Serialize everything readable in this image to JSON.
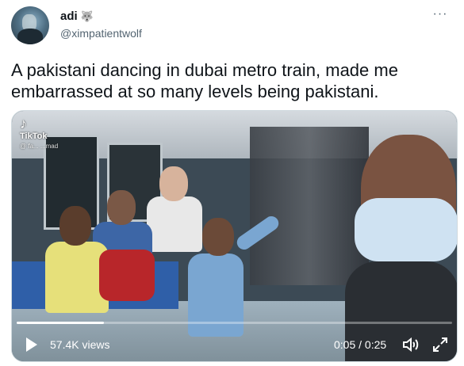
{
  "tweet": {
    "author": {
      "display_name": "adi",
      "name_emoji": "🐺",
      "handle": "@ximpatientwolf"
    },
    "more_label": "···",
    "text": "A pakistani dancing in dubai metro train, made me embarrassed at so many levels being pakistani.",
    "video": {
      "watermark": "TikTok",
      "watermark_user": "@ fa... ...mad",
      "views": "57.4K views",
      "time": "0:05 / 0:25",
      "progress": 0.2
    }
  },
  "icons": {
    "more": "more-horizontal-icon",
    "play": "play-icon",
    "volume": "volume-icon",
    "fullscreen": "fullscreen-icon",
    "tiktok": "tiktok-logo-icon"
  }
}
